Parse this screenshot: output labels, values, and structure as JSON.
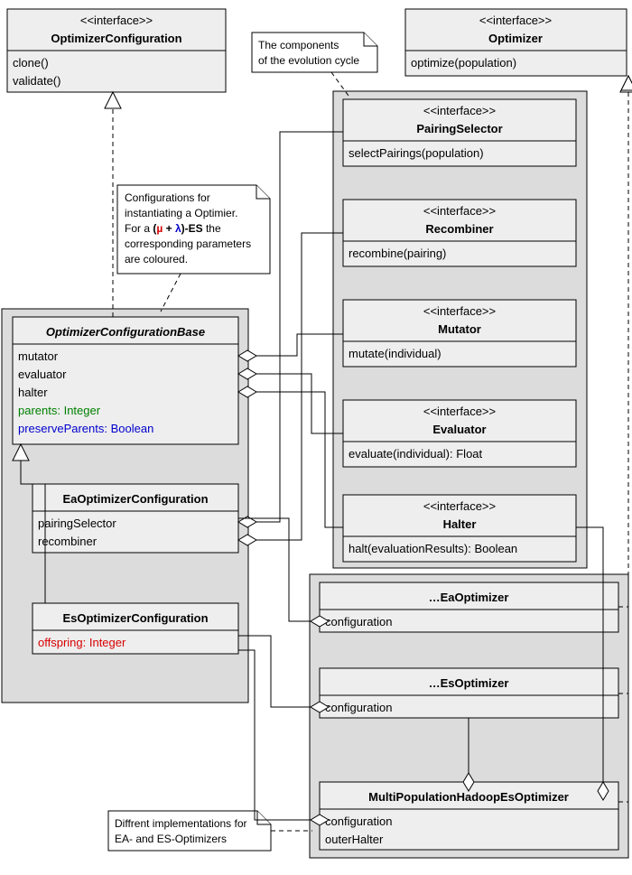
{
  "optimizerConfig": {
    "stereo": "<<interface>>",
    "name": "OptimizerConfiguration",
    "m1": "clone()",
    "m2": "validate()"
  },
  "optimizer": {
    "stereo": "<<interface>>",
    "name": "Optimizer",
    "m1": "optimize(population)"
  },
  "note1": {
    "l1": "The components",
    "l2": "of the evolution cycle"
  },
  "note2": {
    "l1": "Configurations for",
    "l2": "instantiating a Optimier.",
    "l3a": "For a ",
    "l3b": "(",
    "l3mu": "µ",
    "l3plus": " + ",
    "l3lam": "λ",
    "l3c": ")-ES",
    "l3d": " the",
    "l4": "corresponding parameters",
    "l5": "are coloured."
  },
  "note3": {
    "l1": "Diffrent implementations for",
    "l2": "EA- and ES-Optimizers"
  },
  "base": {
    "name": "OptimizerConfigurationBase",
    "a1": "mutator",
    "a2": "evaluator",
    "a3": "halter",
    "a4": "parents: Integer",
    "a5": "preserveParents: Boolean"
  },
  "eaConfig": {
    "name": "EaOptimizerConfiguration",
    "a1": "pairingSelector",
    "a2": "recombiner"
  },
  "esConfig": {
    "name": "EsOptimizerConfiguration",
    "a1": "offspring: Integer"
  },
  "pairing": {
    "stereo": "<<interface>>",
    "name": "PairingSelector",
    "m1": "selectPairings(population)"
  },
  "recombiner": {
    "stereo": "<<interface>>",
    "name": "Recombiner",
    "m1": "recombine(pairing)"
  },
  "mutator": {
    "stereo": "<<interface>>",
    "name": "Mutator",
    "m1": "mutate(individual)"
  },
  "evaluator": {
    "stereo": "<<interface>>",
    "name": "Evaluator",
    "m1": "evaluate(individual): Float"
  },
  "halter": {
    "stereo": "<<interface>>",
    "name": "Halter",
    "m1": "halt(evaluationResults): Boolean"
  },
  "eaOpt": {
    "name": "…EaOptimizer",
    "a1": "configuration"
  },
  "esOpt": {
    "name": "…EsOptimizer",
    "a1": "configuration"
  },
  "mpOpt": {
    "name": "MultiPopulationHadoopEsOptimizer",
    "a1": "configuration",
    "a2": "outerHalter"
  }
}
